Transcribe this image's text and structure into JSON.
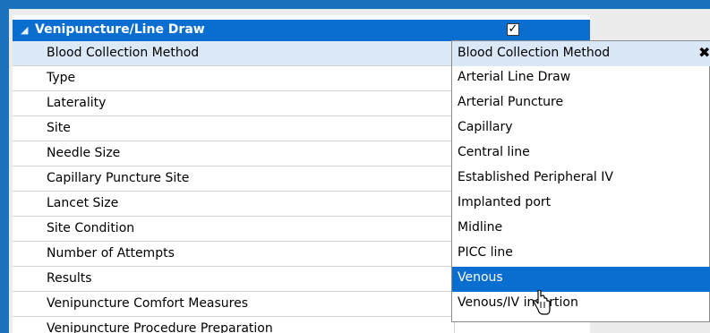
{
  "section": {
    "title": "Venipuncture/Line Draw",
    "expand_glyph": "◢",
    "checked": true
  },
  "rows": [
    {
      "label": "Blood Collection Method"
    },
    {
      "label": "Type"
    },
    {
      "label": "Laterality"
    },
    {
      "label": "Site"
    },
    {
      "label": "Needle Size"
    },
    {
      "label": "Capillary Puncture Site"
    },
    {
      "label": "Lancet Size"
    },
    {
      "label": "Site Condition"
    },
    {
      "label": "Number of Attempts"
    },
    {
      "label": "Results"
    },
    {
      "label": "Venipuncture Comfort Measures"
    },
    {
      "label": "Venipuncture Procedure Preparation"
    }
  ],
  "dropdown": {
    "header": "Blood Collection Method",
    "close_glyph": "✖",
    "options": [
      "Arterial Line Draw",
      "Arterial Puncture",
      "Capillary",
      "Central line",
      "Established Peripheral IV",
      "Implanted port",
      "Midline",
      "PICC line",
      "Venous",
      "Venous/IV insertion"
    ],
    "selected": "Venous"
  },
  "colors": {
    "accent": "#0a6ed1",
    "frame": "#1b72bd",
    "row_selected": "#dbe9f7"
  },
  "icons": {
    "cursor": "hand-pointer-icon"
  }
}
